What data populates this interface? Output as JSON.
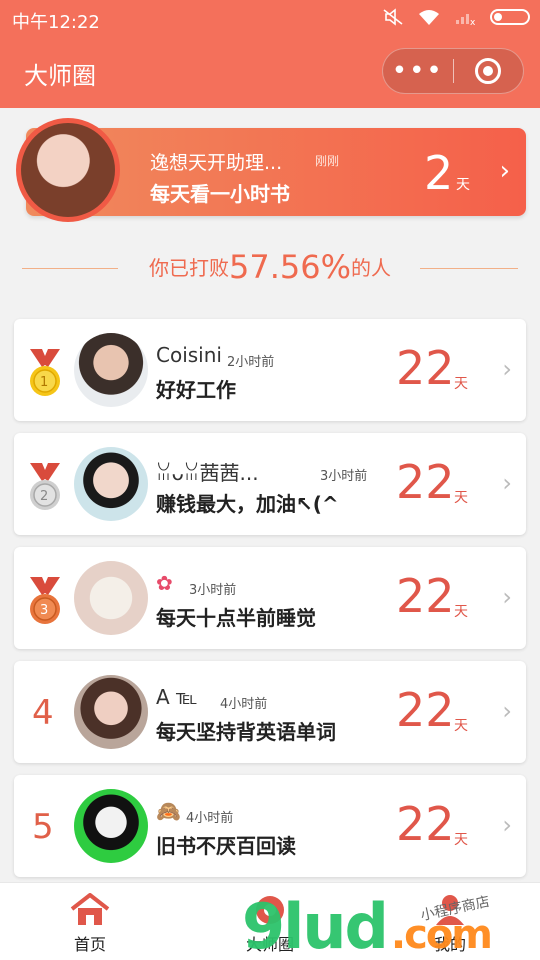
{
  "status_bar": {
    "time": "中午12:22"
  },
  "header": {
    "title": "大师圈",
    "more_label": "•••"
  },
  "colors": {
    "accent": "#f4705b",
    "days": "#e0574a"
  },
  "banner": {
    "name": "逸想天开助理...",
    "time": "刚刚",
    "goal": "每天看一小时书",
    "days": "2",
    "unit": "天"
  },
  "beat": {
    "prefix": "你已打败",
    "percent": "57.56%",
    "suffix": "的人"
  },
  "rankings": [
    {
      "rank": "1",
      "name": "Coisini",
      "ago": "2小时前",
      "goal": "好好工作",
      "days": "22",
      "unit": "天"
    },
    {
      "rank": "2",
      "name": "ꈍᴗꈍ茜茜...",
      "ago": "3小时前",
      "goal": "赚钱最大，加油↖(^",
      "days": "22",
      "unit": "天"
    },
    {
      "rank": "3",
      "name": "",
      "ago": "3小时前",
      "goal": "每天十点半前睡觉",
      "days": "22",
      "unit": "天"
    },
    {
      "rank": "4",
      "name": "A ℡",
      "ago": "4小时前",
      "goal": "每天坚持背英语单词",
      "days": "22",
      "unit": "天"
    },
    {
      "rank": "5",
      "name": "",
      "ago": "4小时前",
      "goal": "旧书不厌百回读",
      "days": "22",
      "unit": "天"
    }
  ],
  "tabbar": [
    {
      "label": "首页",
      "icon": "home-icon"
    },
    {
      "label": "大师圈",
      "icon": "circle-icon"
    },
    {
      "label": "我的",
      "icon": "user-icon"
    }
  ],
  "watermark": {
    "main": "9lud",
    "suffix": ".com",
    "small": "小程序商店"
  }
}
